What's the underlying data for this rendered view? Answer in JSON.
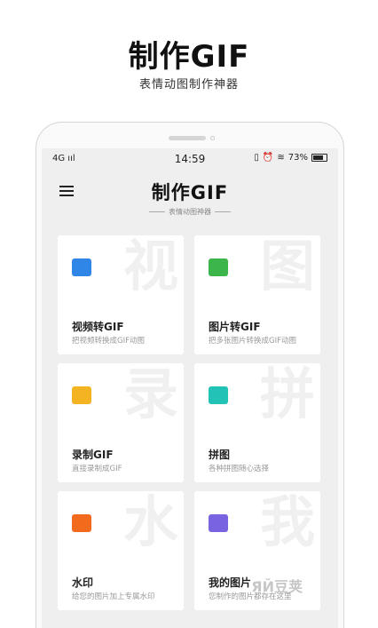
{
  "promo": {
    "title": "制作GIF",
    "subtitle": "表情动图制作神器"
  },
  "status_bar": {
    "signal": "4G ııl",
    "time": "14:59",
    "battery": "73%"
  },
  "app": {
    "title": "制作GIF",
    "subtitle": "表情动图神器"
  },
  "cards": [
    {
      "title": "视频转GIF",
      "desc": "把视频转换成GIF动图",
      "bg_char": "视",
      "icon": "video-icon",
      "color": "#2f86e6"
    },
    {
      "title": "图片转GIF",
      "desc": "把多张图片转换成GIF动图",
      "bg_char": "图",
      "icon": "image-icon",
      "color": "#3cb54a"
    },
    {
      "title": "录制GIF",
      "desc": "直接录制成GIF",
      "bg_char": "录",
      "icon": "gif-file-icon",
      "color": "#f4b323"
    },
    {
      "title": "拼图",
      "desc": "各种拼图随心选择",
      "bg_char": "拼",
      "icon": "puzzle-icon",
      "color": "#22c2b7"
    },
    {
      "title": "水印",
      "desc": "给您的图片加上专属水印",
      "bg_char": "水",
      "icon": "watermark-icon",
      "color": "#f26a1b"
    },
    {
      "title": "我的图片",
      "desc": "您制作的图片都存在这里",
      "bg_char": "我",
      "icon": "gallery-icon",
      "color": "#7a63e0"
    }
  ],
  "watermark": "ЯЙ豆荚"
}
